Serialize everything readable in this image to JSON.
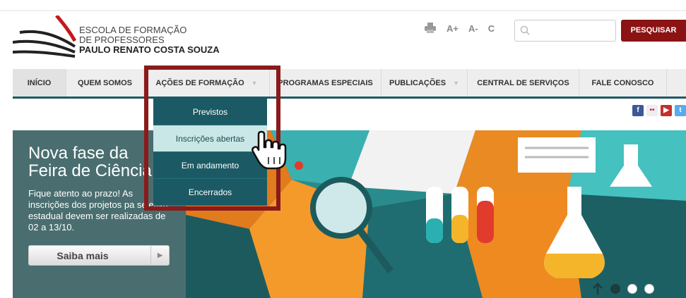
{
  "header": {
    "logo_line1": "ESCOLA DE FORMAÇÃO",
    "logo_line2": "DE PROFESSORES",
    "logo_line3": "PAULO RENATO COSTA SOUZA",
    "tools": {
      "font_increase": "A+",
      "font_decrease": "A-",
      "contrast": "C"
    },
    "search_placeholder": "",
    "search_button": "PESQUISAR"
  },
  "nav": {
    "items": [
      {
        "label": "INÍCIO",
        "has_dropdown": false
      },
      {
        "label": "QUEM SOMOS",
        "has_dropdown": false
      },
      {
        "label": "AÇÕES DE FORMAÇÃO",
        "has_dropdown": true
      },
      {
        "label": "PROGRAMAS ESPECIAIS",
        "has_dropdown": false
      },
      {
        "label": "PUBLICAÇÕES",
        "has_dropdown": true
      },
      {
        "label": "CENTRAL DE SERVIÇOS",
        "has_dropdown": false
      },
      {
        "label": "FALE CONOSCO",
        "has_dropdown": false
      }
    ]
  },
  "dropdown": {
    "items": [
      "Previstos",
      "Inscrições abertas",
      "Em andamento",
      "Encerrados"
    ],
    "hovered_index": 1
  },
  "social": [
    "facebook-icon",
    "flickr-icon",
    "youtube-icon",
    "twitter-icon"
  ],
  "hero": {
    "title_line1": "Nova fase da",
    "title_line2": "Feira de Ciência",
    "text": "Fique atento ao prazo! As inscrições dos projetos pa seletiva estadual devem ser realizadas de 02 a 13/10.",
    "button": "Saiba mais"
  },
  "colors": {
    "brand_red": "#8b1313",
    "nav_teal": "#1b5a64",
    "highlight": "#8b1a1a"
  }
}
